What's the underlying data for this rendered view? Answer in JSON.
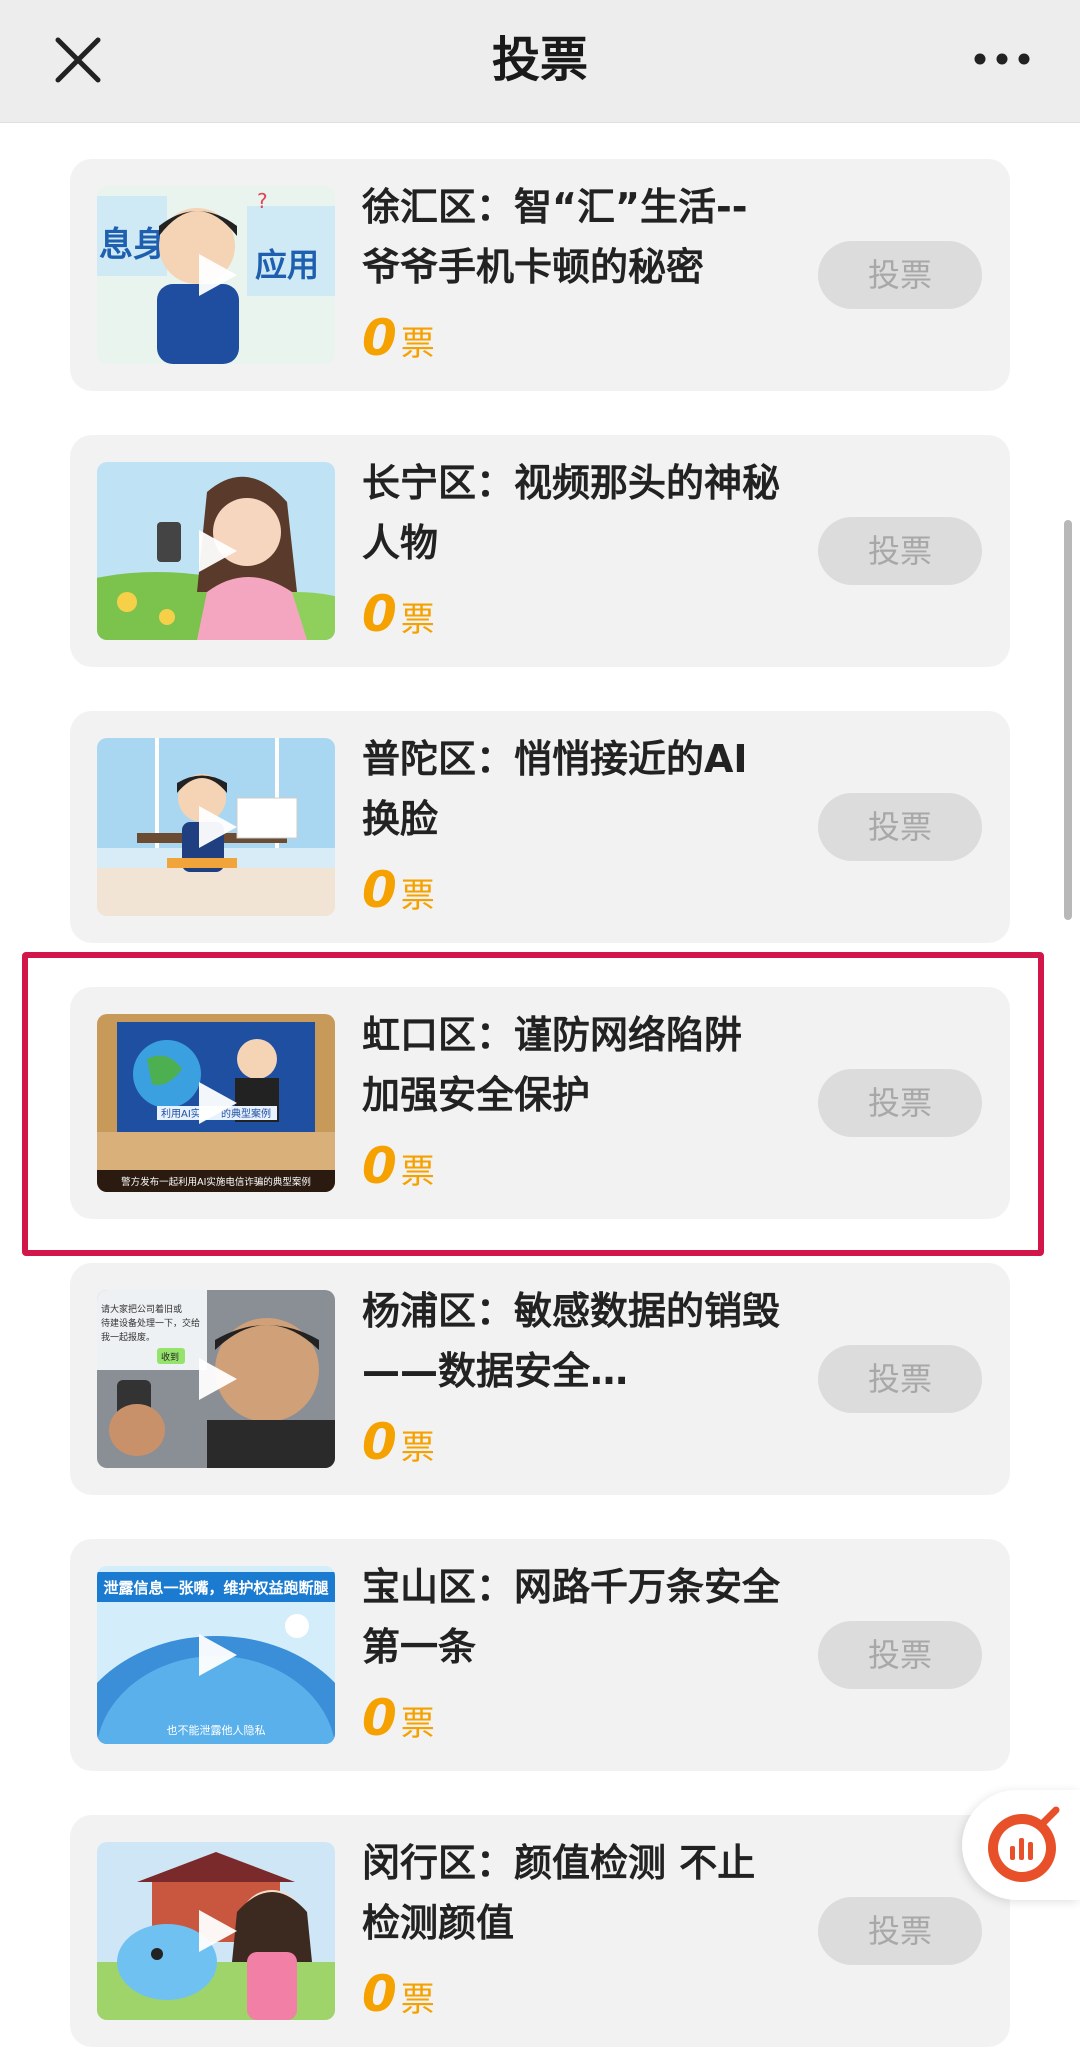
{
  "header": {
    "title": "投票"
  },
  "items": [
    {
      "title": "徐汇区：智“汇”生活--爷爷手机卡顿的秘密",
      "votes": "0",
      "unit": "票",
      "button": "投票"
    },
    {
      "title": "长宁区：视频那头的神秘人物",
      "votes": "0",
      "unit": "票",
      "button": "投票"
    },
    {
      "title": "普陀区：悄悄接近的AI换脸",
      "votes": "0",
      "unit": "票",
      "button": "投票"
    },
    {
      "title": "虹口区：谨防网络陷阱 加强安全保护",
      "votes": "0",
      "unit": "票",
      "button": "投票"
    },
    {
      "title": "杨浦区：敏感数据的销毁——数据安全…",
      "votes": "0",
      "unit": "票",
      "button": "投票"
    },
    {
      "title": "宝山区：网路千万条安全第一条",
      "votes": "0",
      "unit": "票",
      "button": "投票"
    },
    {
      "title": "闵行区：颜值检测 不止检测颜值",
      "votes": "0",
      "unit": "票",
      "button": "投票"
    }
  ],
  "thumb_text": {
    "item0": [
      "息身",
      "应用"
    ],
    "item3": [
      "利用AI实",
      "的典型案例",
      "警方发布一起利用AI实施电信诈骗的典型案例"
    ],
    "item4": [
      "请大家把公司着旧或",
      "待建设备处理一下，交给",
      "我一起报废。",
      "收到"
    ],
    "item5": [
      "泄露信息一张嘴，维护权益跑断腿",
      "也不能泄露他人隐私"
    ]
  },
  "colors": {
    "accent": "#f5a100",
    "highlight": "#d3164a",
    "button_bg": "#dcdcdc",
    "card_bg": "#f2f2f2"
  },
  "icons": {
    "close": "close-icon",
    "more": "more-icon",
    "play": "play-icon",
    "float": "chart-icon"
  }
}
